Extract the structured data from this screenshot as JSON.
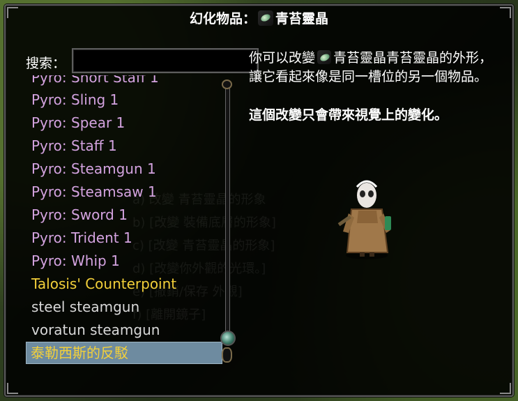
{
  "dialog": {
    "title_prefix": "幻化物品：",
    "item_name": "青苔靈晶"
  },
  "search": {
    "label": "搜索：",
    "value": ""
  },
  "list": {
    "items": [
      {
        "label": "Pyro: Short Staff 1",
        "color": "#d4a3e0"
      },
      {
        "label": "Pyro: Sling 1",
        "color": "#d4a3e0"
      },
      {
        "label": "Pyro: Spear 1",
        "color": "#d4a3e0"
      },
      {
        "label": "Pyro: Staff 1",
        "color": "#d4a3e0"
      },
      {
        "label": "Pyro: Steamgun 1",
        "color": "#d4a3e0"
      },
      {
        "label": "Pyro: Steamsaw 1",
        "color": "#d4a3e0"
      },
      {
        "label": "Pyro: Sword 1",
        "color": "#d4a3e0"
      },
      {
        "label": "Pyro: Trident 1",
        "color": "#d4a3e0"
      },
      {
        "label": "Pyro: Whip 1",
        "color": "#d4a3e0"
      },
      {
        "label": "Talosis' Counterpoint",
        "color": "#f3d03a"
      },
      {
        "label": "steel steamgun",
        "color": "#d8d8d8"
      },
      {
        "label": "voratun steamgun",
        "color": "#d8d8d8"
      },
      {
        "label": "泰勒西斯的反駁",
        "color": "#f3d03a",
        "selected": true
      }
    ]
  },
  "description": {
    "prefix": "你可以改變",
    "suffix": "青苔靈晶的外形，讓它看起來像是同一槽位的另一個物品。",
    "warning": "這個改變只會帶來視覺上的變化。"
  },
  "ghost_lines": [
    "a) 改變 青苔靈晶的形象",
    "b) [改變 裝備底層的形象]",
    "c) [改變 青苔靈晶的形象]",
    "d) [改變你外觀的光環。]",
    "e) [撤銷/保存 外觀]",
    "f) [離開鏡子]"
  ],
  "colors": {
    "pyro_item": "#d4a3e0",
    "unique_item": "#f3d03a",
    "normal_item": "#d8d8d8",
    "selection_bg": "#6e8ba0"
  }
}
